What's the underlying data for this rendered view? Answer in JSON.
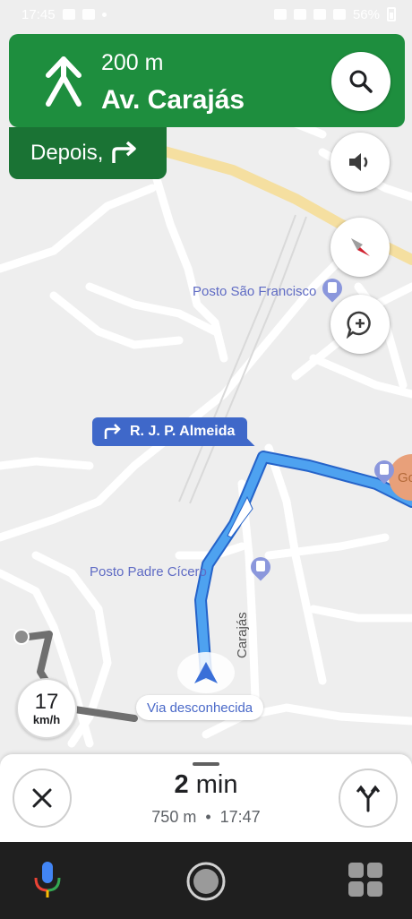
{
  "status_bar": {
    "time": "17:45",
    "battery": "56%"
  },
  "navigation": {
    "distance": "200 m",
    "street": "Av. Carajás",
    "then_label": "Depois,"
  },
  "map": {
    "poi_1": "Posto São Francisco",
    "poi_2": "Posto Padre Cícero",
    "poi_3": "Go",
    "road_label": "Carajás",
    "turn_callout": "R. J. P. Almeida",
    "unknown_road": "Via desconhecida"
  },
  "speed": {
    "value": "17",
    "unit": "km/h"
  },
  "trip": {
    "duration_value": "2",
    "duration_unit": "min",
    "distance": "750 m",
    "separator": "•",
    "arrival": "17:47"
  },
  "colors": {
    "nav_green": "#1e8e3e",
    "then_green": "#1a7334",
    "route_blue": "#4a8fe8"
  }
}
